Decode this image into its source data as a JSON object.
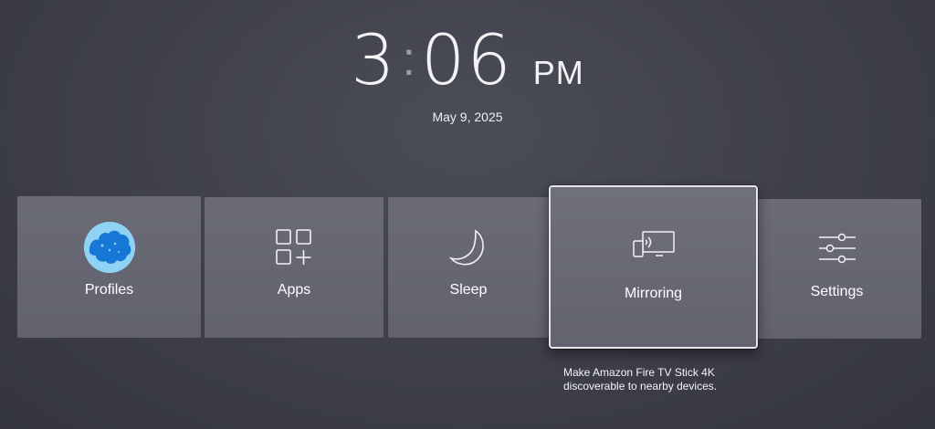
{
  "clock": {
    "hour": "3",
    "minute": "06",
    "ampm": "PM",
    "date": "May 9, 2025"
  },
  "tiles": [
    {
      "id": "profiles",
      "label": "Profiles",
      "icon": "profile-avatar"
    },
    {
      "id": "apps",
      "label": "Apps",
      "icon": "apps-grid-icon"
    },
    {
      "id": "sleep",
      "label": "Sleep",
      "icon": "moon-icon"
    },
    {
      "id": "mirroring",
      "label": "Mirroring",
      "icon": "screen-mirroring-icon",
      "focused": true
    },
    {
      "id": "settings",
      "label": "Settings",
      "icon": "sliders-icon"
    }
  ],
  "focused_description": "Make Amazon Fire TV Stick 4K discoverable to nearby devices.",
  "colors": {
    "background": "#3e3f49",
    "tile": "#666772",
    "focus_border": "#e6e6ea",
    "avatar": "#8fd2f4",
    "avatar_figure": "#1677d6"
  }
}
